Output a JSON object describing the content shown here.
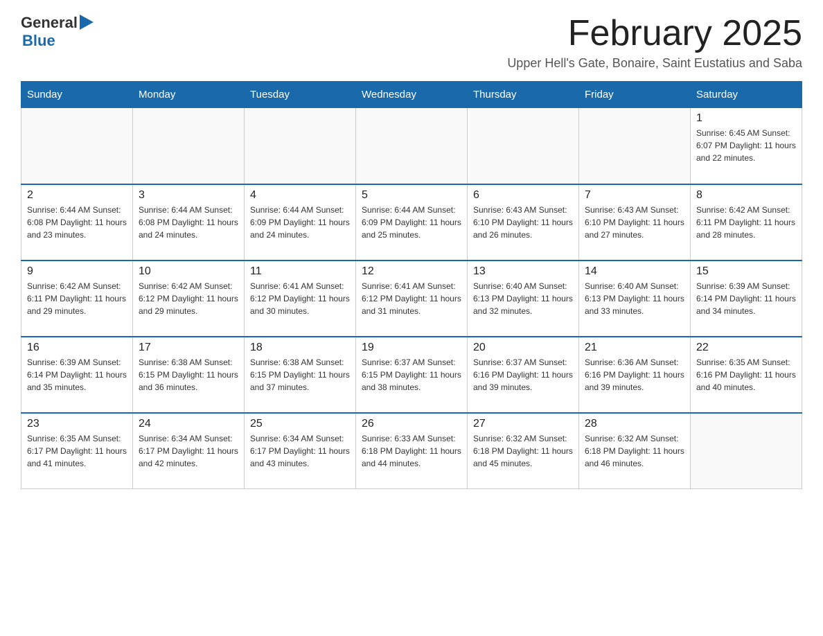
{
  "header": {
    "logo_general": "General",
    "logo_blue": "Blue",
    "month_title": "February 2025",
    "location": "Upper Hell's Gate, Bonaire, Saint Eustatius and Saba"
  },
  "weekdays": [
    "Sunday",
    "Monday",
    "Tuesday",
    "Wednesday",
    "Thursday",
    "Friday",
    "Saturday"
  ],
  "weeks": [
    {
      "days": [
        {
          "number": "",
          "info": ""
        },
        {
          "number": "",
          "info": ""
        },
        {
          "number": "",
          "info": ""
        },
        {
          "number": "",
          "info": ""
        },
        {
          "number": "",
          "info": ""
        },
        {
          "number": "",
          "info": ""
        },
        {
          "number": "1",
          "info": "Sunrise: 6:45 AM\nSunset: 6:07 PM\nDaylight: 11 hours and 22 minutes."
        }
      ]
    },
    {
      "days": [
        {
          "number": "2",
          "info": "Sunrise: 6:44 AM\nSunset: 6:08 PM\nDaylight: 11 hours and 23 minutes."
        },
        {
          "number": "3",
          "info": "Sunrise: 6:44 AM\nSunset: 6:08 PM\nDaylight: 11 hours and 24 minutes."
        },
        {
          "number": "4",
          "info": "Sunrise: 6:44 AM\nSunset: 6:09 PM\nDaylight: 11 hours and 24 minutes."
        },
        {
          "number": "5",
          "info": "Sunrise: 6:44 AM\nSunset: 6:09 PM\nDaylight: 11 hours and 25 minutes."
        },
        {
          "number": "6",
          "info": "Sunrise: 6:43 AM\nSunset: 6:10 PM\nDaylight: 11 hours and 26 minutes."
        },
        {
          "number": "7",
          "info": "Sunrise: 6:43 AM\nSunset: 6:10 PM\nDaylight: 11 hours and 27 minutes."
        },
        {
          "number": "8",
          "info": "Sunrise: 6:42 AM\nSunset: 6:11 PM\nDaylight: 11 hours and 28 minutes."
        }
      ]
    },
    {
      "days": [
        {
          "number": "9",
          "info": "Sunrise: 6:42 AM\nSunset: 6:11 PM\nDaylight: 11 hours and 29 minutes."
        },
        {
          "number": "10",
          "info": "Sunrise: 6:42 AM\nSunset: 6:12 PM\nDaylight: 11 hours and 29 minutes."
        },
        {
          "number": "11",
          "info": "Sunrise: 6:41 AM\nSunset: 6:12 PM\nDaylight: 11 hours and 30 minutes."
        },
        {
          "number": "12",
          "info": "Sunrise: 6:41 AM\nSunset: 6:12 PM\nDaylight: 11 hours and 31 minutes."
        },
        {
          "number": "13",
          "info": "Sunrise: 6:40 AM\nSunset: 6:13 PM\nDaylight: 11 hours and 32 minutes."
        },
        {
          "number": "14",
          "info": "Sunrise: 6:40 AM\nSunset: 6:13 PM\nDaylight: 11 hours and 33 minutes."
        },
        {
          "number": "15",
          "info": "Sunrise: 6:39 AM\nSunset: 6:14 PM\nDaylight: 11 hours and 34 minutes."
        }
      ]
    },
    {
      "days": [
        {
          "number": "16",
          "info": "Sunrise: 6:39 AM\nSunset: 6:14 PM\nDaylight: 11 hours and 35 minutes."
        },
        {
          "number": "17",
          "info": "Sunrise: 6:38 AM\nSunset: 6:15 PM\nDaylight: 11 hours and 36 minutes."
        },
        {
          "number": "18",
          "info": "Sunrise: 6:38 AM\nSunset: 6:15 PM\nDaylight: 11 hours and 37 minutes."
        },
        {
          "number": "19",
          "info": "Sunrise: 6:37 AM\nSunset: 6:15 PM\nDaylight: 11 hours and 38 minutes."
        },
        {
          "number": "20",
          "info": "Sunrise: 6:37 AM\nSunset: 6:16 PM\nDaylight: 11 hours and 39 minutes."
        },
        {
          "number": "21",
          "info": "Sunrise: 6:36 AM\nSunset: 6:16 PM\nDaylight: 11 hours and 39 minutes."
        },
        {
          "number": "22",
          "info": "Sunrise: 6:35 AM\nSunset: 6:16 PM\nDaylight: 11 hours and 40 minutes."
        }
      ]
    },
    {
      "days": [
        {
          "number": "23",
          "info": "Sunrise: 6:35 AM\nSunset: 6:17 PM\nDaylight: 11 hours and 41 minutes."
        },
        {
          "number": "24",
          "info": "Sunrise: 6:34 AM\nSunset: 6:17 PM\nDaylight: 11 hours and 42 minutes."
        },
        {
          "number": "25",
          "info": "Sunrise: 6:34 AM\nSunset: 6:17 PM\nDaylight: 11 hours and 43 minutes."
        },
        {
          "number": "26",
          "info": "Sunrise: 6:33 AM\nSunset: 6:18 PM\nDaylight: 11 hours and 44 minutes."
        },
        {
          "number": "27",
          "info": "Sunrise: 6:32 AM\nSunset: 6:18 PM\nDaylight: 11 hours and 45 minutes."
        },
        {
          "number": "28",
          "info": "Sunrise: 6:32 AM\nSunset: 6:18 PM\nDaylight: 11 hours and 46 minutes."
        },
        {
          "number": "",
          "info": ""
        }
      ]
    }
  ]
}
